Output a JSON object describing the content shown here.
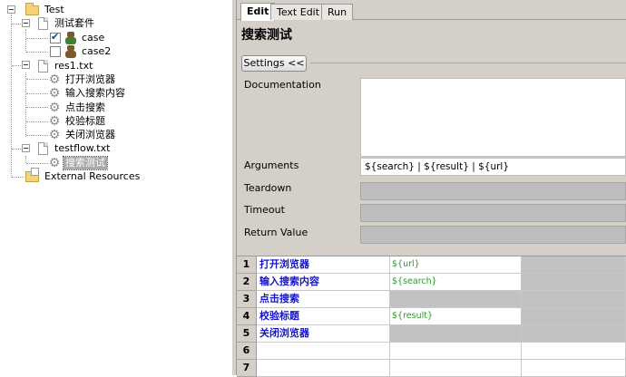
{
  "tree": {
    "root": {
      "label": "Test",
      "icon": "folder-icon"
    },
    "suite": {
      "label": "测试套件",
      "icon": "file-icon"
    },
    "tests": [
      {
        "label": "case",
        "checked": true,
        "icon": "robot-icon"
      },
      {
        "label": "case2",
        "checked": false,
        "icon": "robot-icon"
      }
    ],
    "resource1": {
      "label": "res1.txt",
      "keywords": [
        "打开浏览器",
        "输入搜索内容",
        "点击搜索",
        "校验标题",
        "关闭浏览器"
      ]
    },
    "resource2": {
      "label": "testflow.txt",
      "keywords": [
        "搜索测试"
      ]
    },
    "external": {
      "label": "External Resources",
      "icon": "external-folder-icon"
    }
  },
  "tabs": [
    "Edit",
    "Text Edit",
    "Run"
  ],
  "active_tab": "Edit",
  "editor": {
    "title": "搜索测试",
    "settings_button": "Settings <<",
    "fields": {
      "documentation": {
        "label": "Documentation",
        "value": ""
      },
      "arguments": {
        "label": "Arguments",
        "value": "${search} | ${result} | ${url}"
      },
      "teardown": {
        "label": "Teardown",
        "value": ""
      },
      "timeout": {
        "label": "Timeout",
        "value": ""
      },
      "return_value": {
        "label": "Return Value",
        "value": ""
      }
    },
    "grid": [
      {
        "num": "1",
        "keyword": "打开浏览器",
        "arg": "${url}"
      },
      {
        "num": "2",
        "keyword": "输入搜索内容",
        "arg": "${search}"
      },
      {
        "num": "3",
        "keyword": "点击搜索",
        "arg": ""
      },
      {
        "num": "4",
        "keyword": "校验标题",
        "arg": "${result}"
      },
      {
        "num": "5",
        "keyword": "关闭浏览器",
        "arg": ""
      },
      {
        "num": "6",
        "keyword": "",
        "arg": ""
      },
      {
        "num": "7",
        "keyword": "",
        "arg": ""
      }
    ]
  }
}
